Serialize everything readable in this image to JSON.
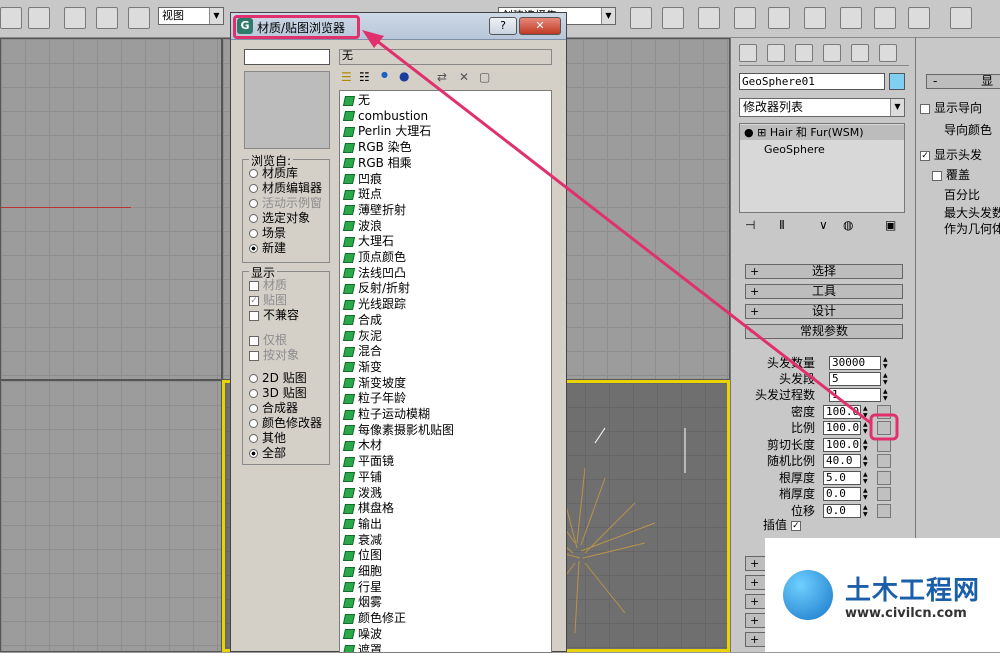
{
  "toolbar": {
    "view_combo": "视图",
    "selection_set_combo": "创建选择集"
  },
  "dialog": {
    "title": "材质/贴图浏览器",
    "help_button": "?",
    "close_button": "✕",
    "name_value": "无",
    "browse_from": {
      "label": "浏览自:",
      "options": [
        {
          "label": "材质库",
          "selected": false,
          "enabled": true
        },
        {
          "label": "材质编辑器",
          "selected": false,
          "enabled": true
        },
        {
          "label": "活动示例窗",
          "selected": false,
          "enabled": false
        },
        {
          "label": "选定对象",
          "selected": false,
          "enabled": true
        },
        {
          "label": "场景",
          "selected": false,
          "enabled": true
        },
        {
          "label": "新建",
          "selected": true,
          "enabled": true
        }
      ]
    },
    "show": {
      "label": "显示",
      "checks": [
        {
          "label": "材质",
          "checked": false,
          "enabled": false
        },
        {
          "label": "贴图",
          "checked": true,
          "enabled": false
        },
        {
          "label": "不兼容",
          "checked": false,
          "enabled": true
        }
      ],
      "checks2": [
        {
          "label": "仅根",
          "checked": false,
          "enabled": false
        },
        {
          "label": "按对象",
          "checked": false,
          "enabled": false
        }
      ],
      "radios": [
        {
          "label": "2D 贴图",
          "selected": false
        },
        {
          "label": "3D 贴图",
          "selected": false
        },
        {
          "label": "合成器",
          "selected": false
        },
        {
          "label": "颜色修改器",
          "selected": false
        },
        {
          "label": "其他",
          "selected": false
        },
        {
          "label": "全部",
          "selected": true
        }
      ]
    },
    "maps": [
      "无",
      "combustion",
      "Perlin 大理石",
      "RGB 染色",
      "RGB 相乘",
      "凹痕",
      "斑点",
      "薄壁折射",
      "波浪",
      "大理石",
      "顶点颜色",
      "法线凹凸",
      "反射/折射",
      "光线跟踪",
      "合成",
      "灰泥",
      "混合",
      "渐变",
      "渐变坡度",
      "粒子年龄",
      "粒子运动模糊",
      "每像素摄影机贴图",
      "木材",
      "平面镜",
      "平铺",
      "泼溅",
      "棋盘格",
      "输出",
      "衰减",
      "位图",
      "细胞",
      "行星",
      "烟雾",
      "颜色修正",
      "噪波",
      "遮罩"
    ]
  },
  "command_panel": {
    "object_name": "GeoSphere01",
    "object_color": "#7fd0f0",
    "modifier_list": "修改器列表",
    "stack": [
      {
        "label": "Hair 和 Fur(WSM)",
        "selected": true
      },
      {
        "label": "GeoSphere",
        "selected": false
      }
    ],
    "rollouts": [
      {
        "label": "选择",
        "sign": "+"
      },
      {
        "label": "工具",
        "sign": "+"
      },
      {
        "label": "设计",
        "sign": "+"
      },
      {
        "label": "常规参数",
        "sign": "-"
      }
    ],
    "params": [
      {
        "label": "头发数量",
        "value": "30000"
      },
      {
        "label": "头发段",
        "value": "5"
      },
      {
        "label": "头发过程数",
        "value": "1"
      },
      {
        "label": "密度",
        "value": "100.0"
      },
      {
        "label": "比例",
        "value": "100.0"
      },
      {
        "label": "剪切长度",
        "value": "100.0"
      },
      {
        "label": "随机比例",
        "value": "40.0"
      },
      {
        "label": "根厚度",
        "value": "5.0"
      },
      {
        "label": "梢厚度",
        "value": "0.0"
      },
      {
        "label": "位移",
        "value": "0.0"
      }
    ],
    "interpolate_label": "插值",
    "interpolate_checked": "✓"
  },
  "side_panel": {
    "rollout_sign": "-",
    "rollout_label": "显",
    "items": [
      {
        "label": "显示导向",
        "checked": false
      },
      {
        "label": "导向颜色",
        "checked": null
      },
      {
        "label": "显示头发",
        "checked": true
      },
      {
        "label": "覆盖",
        "checked": false
      },
      {
        "label": "百分比",
        "checked": null
      },
      {
        "label": "最大头发数",
        "checked": null
      },
      {
        "label": "作为几何体",
        "checked": null
      }
    ]
  },
  "watermark": {
    "main": "土木工程网",
    "sub": "www.civilcn.com"
  },
  "colors": {
    "highlight": "#e0306e",
    "dialog_bg": "#d4d0c8",
    "panel_bg": "#c8c8c8"
  }
}
